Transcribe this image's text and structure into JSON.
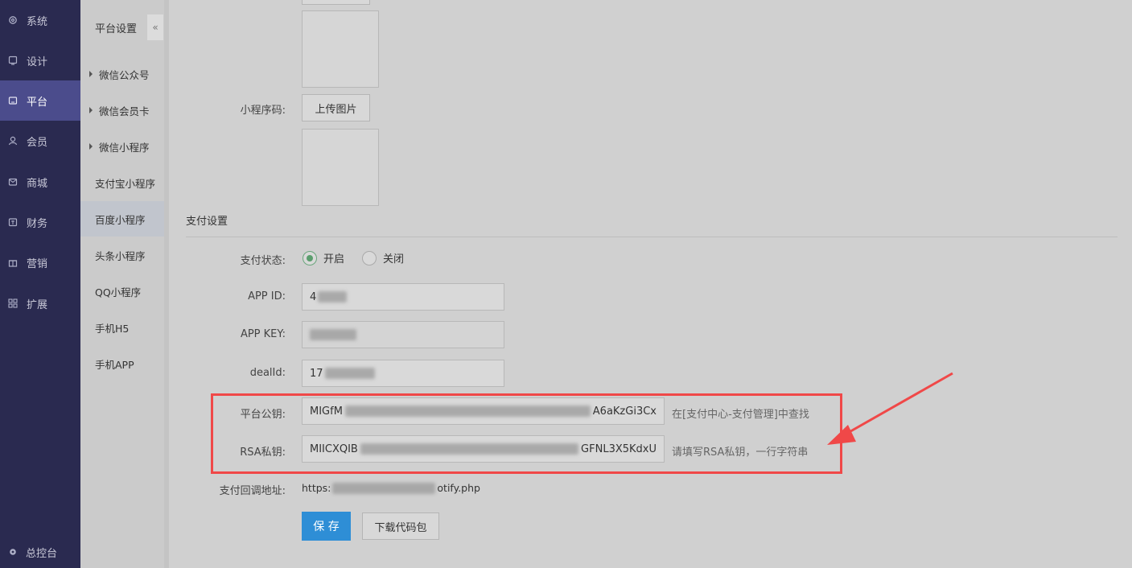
{
  "nav": {
    "items": [
      {
        "label": "系统",
        "icon": "gear-icon"
      },
      {
        "label": "设计",
        "icon": "monitor-icon"
      },
      {
        "label": "平台",
        "icon": "tablet-icon"
      },
      {
        "label": "会员",
        "icon": "user-icon"
      },
      {
        "label": "商城",
        "icon": "mail-icon"
      },
      {
        "label": "财务",
        "icon": "wallet-icon"
      },
      {
        "label": "营销",
        "icon": "gift-icon"
      },
      {
        "label": "扩展",
        "icon": "grid-icon"
      }
    ],
    "active": "平台",
    "bottom_label": "总控台",
    "bottom_icon": "settings-icon"
  },
  "subnav": {
    "title": "平台设置",
    "collapse_icon": "double-chevron-left-icon",
    "items": [
      {
        "label": "微信公众号",
        "expandable": true
      },
      {
        "label": "微信会员卡",
        "expandable": true
      },
      {
        "label": "微信小程序",
        "expandable": true
      },
      {
        "label": "支付宝小程序",
        "expandable": false
      },
      {
        "label": "百度小程序",
        "expandable": false
      },
      {
        "label": "头条小程序",
        "expandable": false
      },
      {
        "label": "QQ小程序",
        "expandable": false
      },
      {
        "label": "手机H5",
        "expandable": false
      },
      {
        "label": "手机APP",
        "expandable": false
      }
    ],
    "active": "百度小程序"
  },
  "form": {
    "miniprogram_code_label": "小程序码:",
    "upload_button": "上传图片",
    "pay_section_title": "支付设置",
    "pay_status_label": "支付状态:",
    "pay_status_options": [
      "开启",
      "关闭"
    ],
    "pay_status_value": "开启",
    "app_id_label": "APP ID:",
    "app_id_value": "4",
    "app_key_label": "APP KEY:",
    "app_key_value": "",
    "deal_id_label": "dealId:",
    "deal_id_value": "17",
    "platform_pubkey_label": "平台公钥:",
    "platform_pubkey_value_start": "MIGfM",
    "platform_pubkey_value_end": "A6aKzGi3Cx",
    "platform_pubkey_hint": "在[支付中心-支付管理]中查找",
    "rsa_privkey_label": "RSA私钥:",
    "rsa_privkey_value_start": "MIICXQIB",
    "rsa_privkey_value_end": "GFNL3X5KdxU",
    "rsa_privkey_hint": "请填写RSA私钥，一行字符串",
    "callback_label": "支付回调地址:",
    "callback_value_start": "https:",
    "callback_value_end": "otify.php",
    "save_button": "保 存",
    "download_button": "下载代码包"
  },
  "annotation": {
    "highlight_color": "#f04848"
  }
}
